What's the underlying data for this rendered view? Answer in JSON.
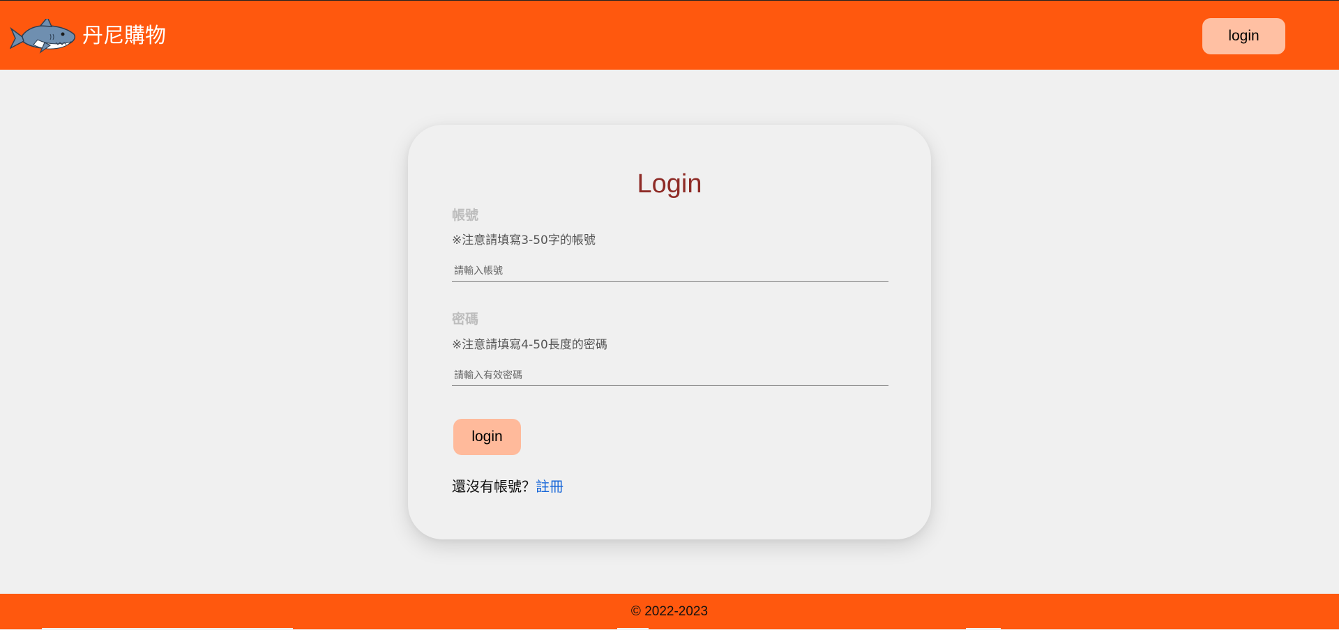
{
  "header": {
    "brand_name": "丹尼購物",
    "logo_icon": "shark-logo-icon",
    "login_label": "login",
    "background": "#ff580e"
  },
  "login_card": {
    "title": "Login",
    "account": {
      "label": "帳號",
      "note": "※注意請填寫3-50字的帳號",
      "value": "",
      "placeholder": "請輸入帳號"
    },
    "password": {
      "label": "密碼",
      "note": "※注意請填寫4-50長度的密碼",
      "value": "",
      "placeholder": "請輸入有效密碼"
    },
    "submit_label": "login",
    "register_prompt": "還沒有帳號？",
    "register_link": "註冊"
  },
  "footer": {
    "copyright": "© 2022-2023"
  }
}
